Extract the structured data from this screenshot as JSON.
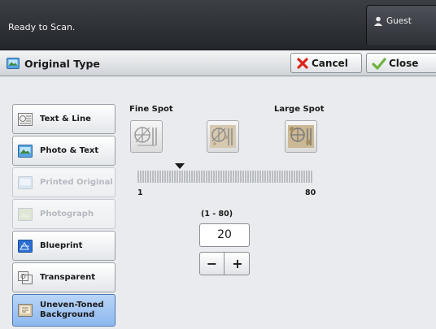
{
  "status": {
    "message": "Ready to Scan.",
    "user_label": "Guest"
  },
  "titlebar": {
    "title": "Original Type",
    "cancel_label": "Cancel",
    "close_label": "Close"
  },
  "original_types": [
    {
      "label": "Text & Line",
      "state": "normal"
    },
    {
      "label": "Photo & Text",
      "state": "normal"
    },
    {
      "label": "Printed Original",
      "state": "disabled"
    },
    {
      "label": "Photograph",
      "state": "disabled"
    },
    {
      "label": "Blueprint",
      "state": "normal"
    },
    {
      "label": "Transparent",
      "state": "normal"
    },
    {
      "label_line1": "Uneven-Toned",
      "label_line2": "Background",
      "state": "selected"
    }
  ],
  "spot": {
    "fine_label": "Fine Spot",
    "large_label": "Large Spot",
    "slider_min": "1",
    "slider_max": "80",
    "range_label": "(1 - 80)",
    "value": "20",
    "minus_label": "−",
    "plus_label": "+"
  },
  "colors": {
    "selected_bg": "#9cc3f2",
    "cancel_x": "#d9261c",
    "close_check": "#6db33f"
  }
}
